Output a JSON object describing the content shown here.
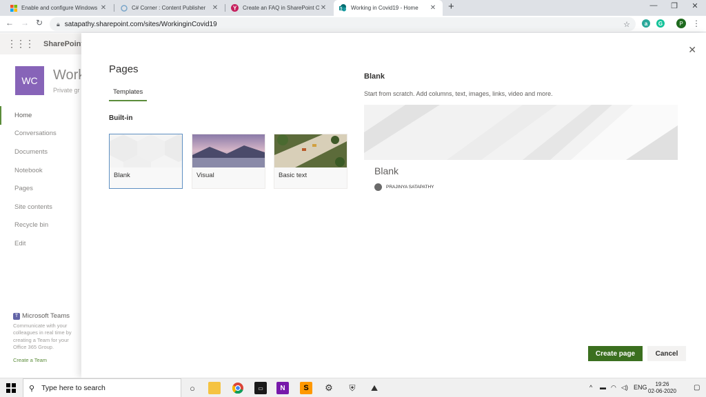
{
  "browser": {
    "tabs": [
      {
        "title": "Enable and configure Windows D",
        "active": false
      },
      {
        "title": "C# Corner : Content Publisher",
        "active": false
      },
      {
        "title": "Create an FAQ in SharePoint Onli",
        "active": false
      },
      {
        "title": "Working in Covid19 - Home",
        "active": true
      }
    ],
    "url": "satapathy.sharepoint.com/sites/WorkinginCovid19",
    "profile_initial": "P"
  },
  "sharepoint": {
    "app_name": "SharePoint",
    "site_initials": "WC",
    "site_name": "Work",
    "site_sub": "Private gr",
    "nav": [
      "Home",
      "Conversations",
      "Documents",
      "Notebook",
      "Pages",
      "Site contents",
      "Recycle bin",
      "Edit"
    ],
    "teams": {
      "title": "Microsoft Teams",
      "desc": "Communicate with your colleagues in real time by creating a Team for your Office 365 Group.",
      "link": "Create a Team"
    }
  },
  "panel": {
    "title": "Pages",
    "tab": "Templates",
    "section": "Built-in",
    "templates": [
      "Blank",
      "Visual",
      "Basic text"
    ],
    "preview": {
      "title": "Blank",
      "description": "Start from scratch. Add columns, text, images, links, video and more.",
      "card_title": "Blank",
      "author": "PRAJINYA SATAPATHY"
    },
    "create_label": "Create page",
    "cancel_label": "Cancel"
  },
  "taskbar": {
    "search_placeholder": "Type here to search",
    "lang": "ENG",
    "time": "19:26",
    "date": "02-06-2020"
  }
}
